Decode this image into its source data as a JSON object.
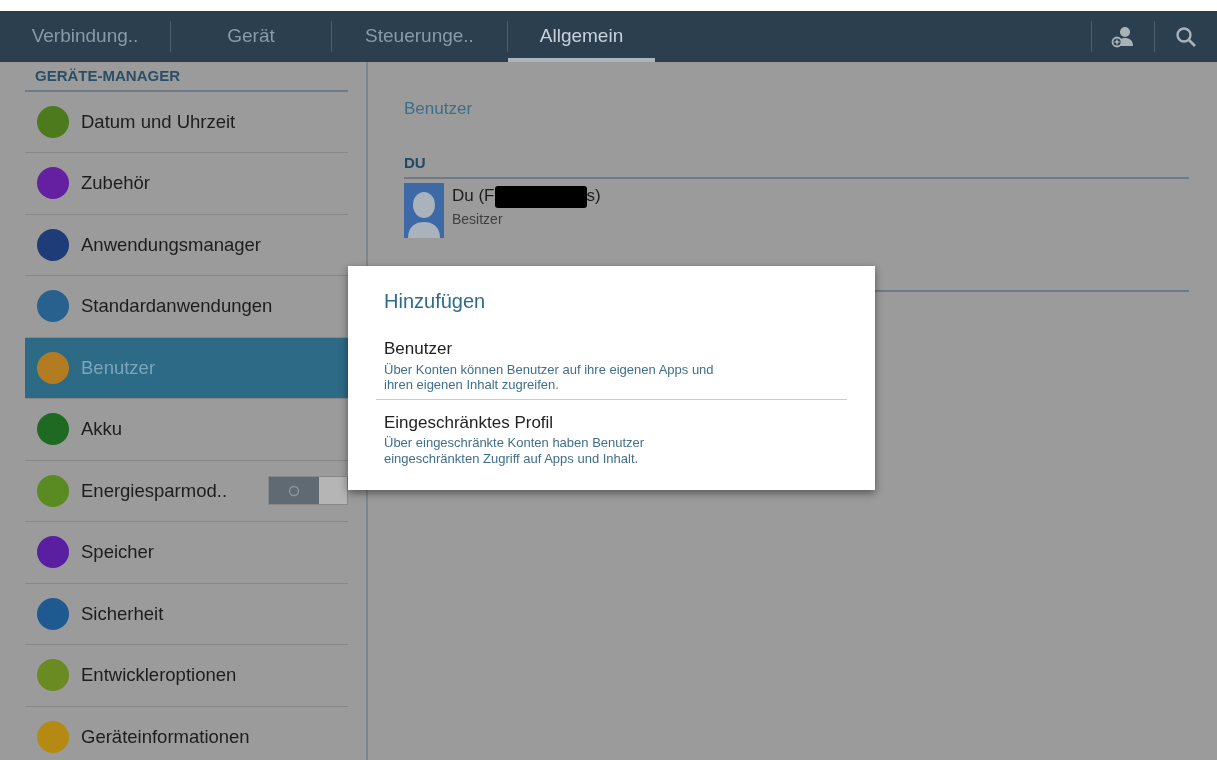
{
  "tabs": [
    {
      "label": "Verbindung..",
      "selected": false
    },
    {
      "label": "Gerät",
      "selected": false
    },
    {
      "label": "Steuerunge..",
      "selected": false
    },
    {
      "label": "Allgemein",
      "selected": true
    }
  ],
  "sidebar": {
    "header": "GERÄTE-MANAGER",
    "items": [
      {
        "label": "Datum und Uhrzeit",
        "color": "#4c7a1c",
        "selected": false,
        "kind": "plain"
      },
      {
        "label": "Zubehör",
        "color": "#6420a0",
        "selected": false,
        "kind": "plain"
      },
      {
        "label": "Anwendungsmanager",
        "color": "#1e3c78",
        "selected": false,
        "kind": "plain"
      },
      {
        "label": "Standardanwendungen",
        "color": "#28608e",
        "selected": false,
        "kind": "plain"
      },
      {
        "label": "Benutzer",
        "color": "#b47c22",
        "selected": true,
        "kind": "plain"
      },
      {
        "label": "Akku",
        "color": "#1e6a22",
        "selected": false,
        "kind": "plain"
      },
      {
        "label": "Energiesparmod..",
        "color": "#5a8a22",
        "selected": false,
        "kind": "toggle",
        "on": false
      },
      {
        "label": "Speicher",
        "color": "#5a1ea0",
        "selected": false,
        "kind": "plain"
      },
      {
        "label": "Sicherheit",
        "color": "#1e5a90",
        "selected": false,
        "kind": "plain"
      },
      {
        "label": "Entwickleroptionen",
        "color": "#6a8a22",
        "selected": false,
        "kind": "plain"
      },
      {
        "label": "Geräteinformationen",
        "color": "#b48a12",
        "selected": false,
        "kind": "plain"
      }
    ]
  },
  "content": {
    "title": "Benutzer",
    "section": "DU",
    "user": {
      "name_start": "Du (F",
      "name_end": "s)",
      "role": "Besitzer"
    }
  },
  "dialog": {
    "title": "Hinzufügen",
    "options": [
      {
        "title": "Benutzer",
        "description": "Über Konten können Benutzer auf ihre eigenen Apps und\nihren eigenen Inhalt zugreifen."
      },
      {
        "title": "Eingeschränktes Profil",
        "description": "Über eingeschränkte Konten haben Benutzer\neingeschränkten Zugriff auf Apps und Inhalt."
      }
    ]
  }
}
